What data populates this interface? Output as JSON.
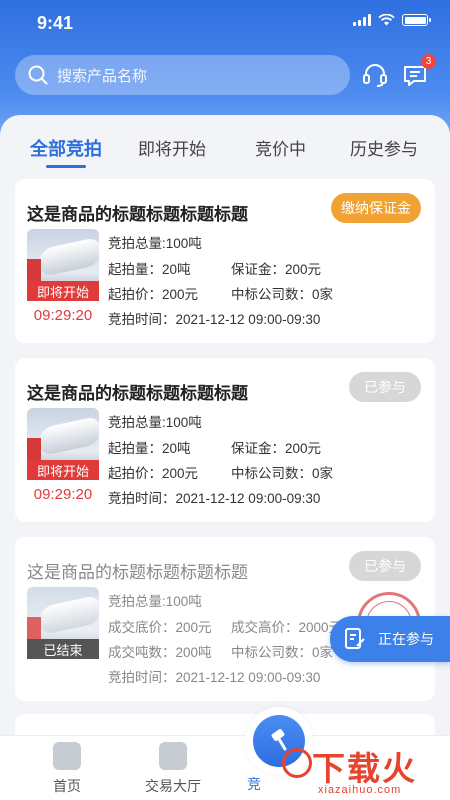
{
  "status_bar": {
    "time": "9:41"
  },
  "header": {
    "search_placeholder": "搜索产品名称",
    "message_badge": "3",
    "icons": [
      "search-icon",
      "headset-icon",
      "message-icon"
    ]
  },
  "tabs": [
    "全部竞拍",
    "即将开始",
    "竞价中",
    "历史参与"
  ],
  "cards": [
    {
      "title": "这是商品的标题标题标题标题",
      "action": "缴纳保证金",
      "thumb_status": "即将开始",
      "countdown": "09:29:20",
      "lines": [
        "竞拍总量:100吨",
        "起拍量：20吨",
        "保证金：200元",
        "起拍价：200元",
        "中标公司数：0家",
        "竞拍时间：2021-12-12 09:00-09:30"
      ]
    },
    {
      "title": "这是商品的标题标题标题标题",
      "action": "已参与",
      "thumb_status": "即将开始",
      "countdown": "09:29:20",
      "lines": [
        "竞拍总量:100吨",
        "起拍量：20吨",
        "保证金：200元",
        "起拍价：200元",
        "中标公司数：0家",
        "竞拍时间：2021-12-12 09:00-09:30"
      ]
    },
    {
      "title": "这是商品的标题标题标题标题",
      "action": "已参与",
      "thumb_status": "已结束",
      "lines": [
        "竞拍总量:100吨",
        "成交底价：200元",
        "成交高价：2000元",
        "成交吨数：200吨",
        "中标公司数：0家",
        "竞拍时间：2021-12-12 09:00-09:30"
      ]
    }
  ],
  "floating_button": "正在参与",
  "bottom_nav": {
    "home": "首页",
    "trade": "交易大厅",
    "auction": "竞"
  },
  "watermark": {
    "main": "下载火",
    "sub": "xiazaihuo.com"
  },
  "colors": {
    "primary": "#2e6fe0",
    "orange": "#f0a232",
    "red": "#e03a3a"
  }
}
